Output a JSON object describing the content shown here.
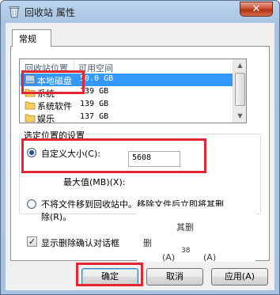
{
  "window": {
    "title": "回收站 属性",
    "close_glyph": "✕"
  },
  "tab": {
    "label": "常规"
  },
  "list": {
    "columns": [
      "回收站位置",
      "可用空间"
    ],
    "rows": [
      {
        "name": "本地磁盘",
        "space": "50.0 GB",
        "selected": true
      },
      {
        "name": "系统",
        "space": "139 GB",
        "selected": false
      },
      {
        "name": "系统软件",
        "space": "139 GB",
        "selected": false
      },
      {
        "name": "娱乐",
        "space": "137 GB",
        "selected": false
      }
    ]
  },
  "settings": {
    "group_label": "选定位置的设置",
    "custom_size_label": "自定义大小(C):",
    "max_size_label": "最大值(MB)(X):",
    "max_size_value": "5608",
    "no_move_label_line1": "不将文件移到回收站中。移除文件后立即将其删",
    "no_move_label_line2": "除(R)。"
  },
  "confirm": {
    "label": "显示删除确认对话框",
    "checked": true,
    "checkmark": "✓"
  },
  "ghost": {
    "text1": "其删",
    "text2": "删",
    "text3": "(A)",
    "text4": "(A)",
    "text5": "38"
  },
  "buttons": {
    "ok": "确定",
    "cancel": "取消",
    "apply": "应用(A)"
  },
  "colors": {
    "selection": "#3399ff",
    "highlight_box": "#e3262f",
    "title_bar": "#a9c4e3"
  },
  "icons": {
    "title": "recycle-bin-icon",
    "drive": "drive-icon",
    "folder": "folder-icon"
  }
}
